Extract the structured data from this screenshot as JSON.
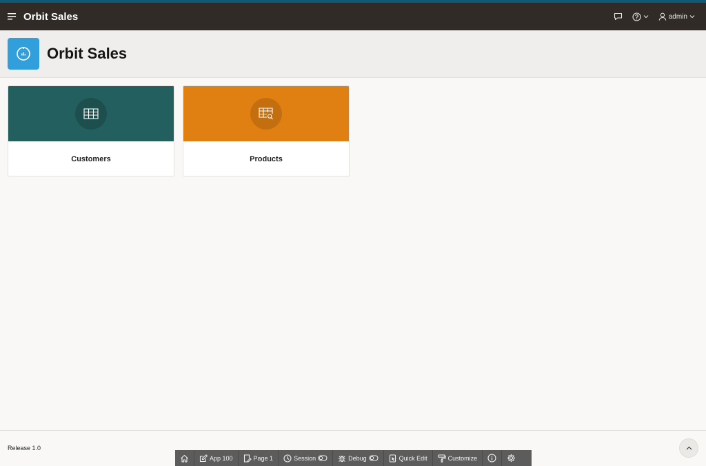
{
  "colors": {
    "accent_bar": "#0c5a78",
    "header_bg": "#302b27",
    "hero_icon_bg": "#309fdb",
    "customers_card": "#235f5e",
    "products_card": "#e07f12"
  },
  "header": {
    "app_name": "Orbit Sales",
    "icons": [
      "menu-icon",
      "chat-icon",
      "help-icon",
      "chevron-down-icon",
      "user-icon"
    ],
    "user": "admin"
  },
  "hero": {
    "title": "Orbit Sales",
    "icon": "dashboard-gauge-icon"
  },
  "cards": [
    {
      "label": "Customers",
      "icon": "table-grid-icon",
      "color": "#235f5e"
    },
    {
      "label": "Products",
      "icon": "table-search-icon",
      "color": "#e07f12"
    }
  ],
  "footer": {
    "release": "Release 1.0",
    "scroll_top_icon": "chevron-up-icon"
  },
  "dev_toolbar": {
    "home_icon": "home-icon",
    "app": "App 100",
    "page": "Page 1",
    "session": "Session",
    "debug": "Debug",
    "quick_edit": "Quick Edit",
    "customize": "Customize",
    "info_icon": "info-icon",
    "settings_icon": "gear-icon"
  }
}
